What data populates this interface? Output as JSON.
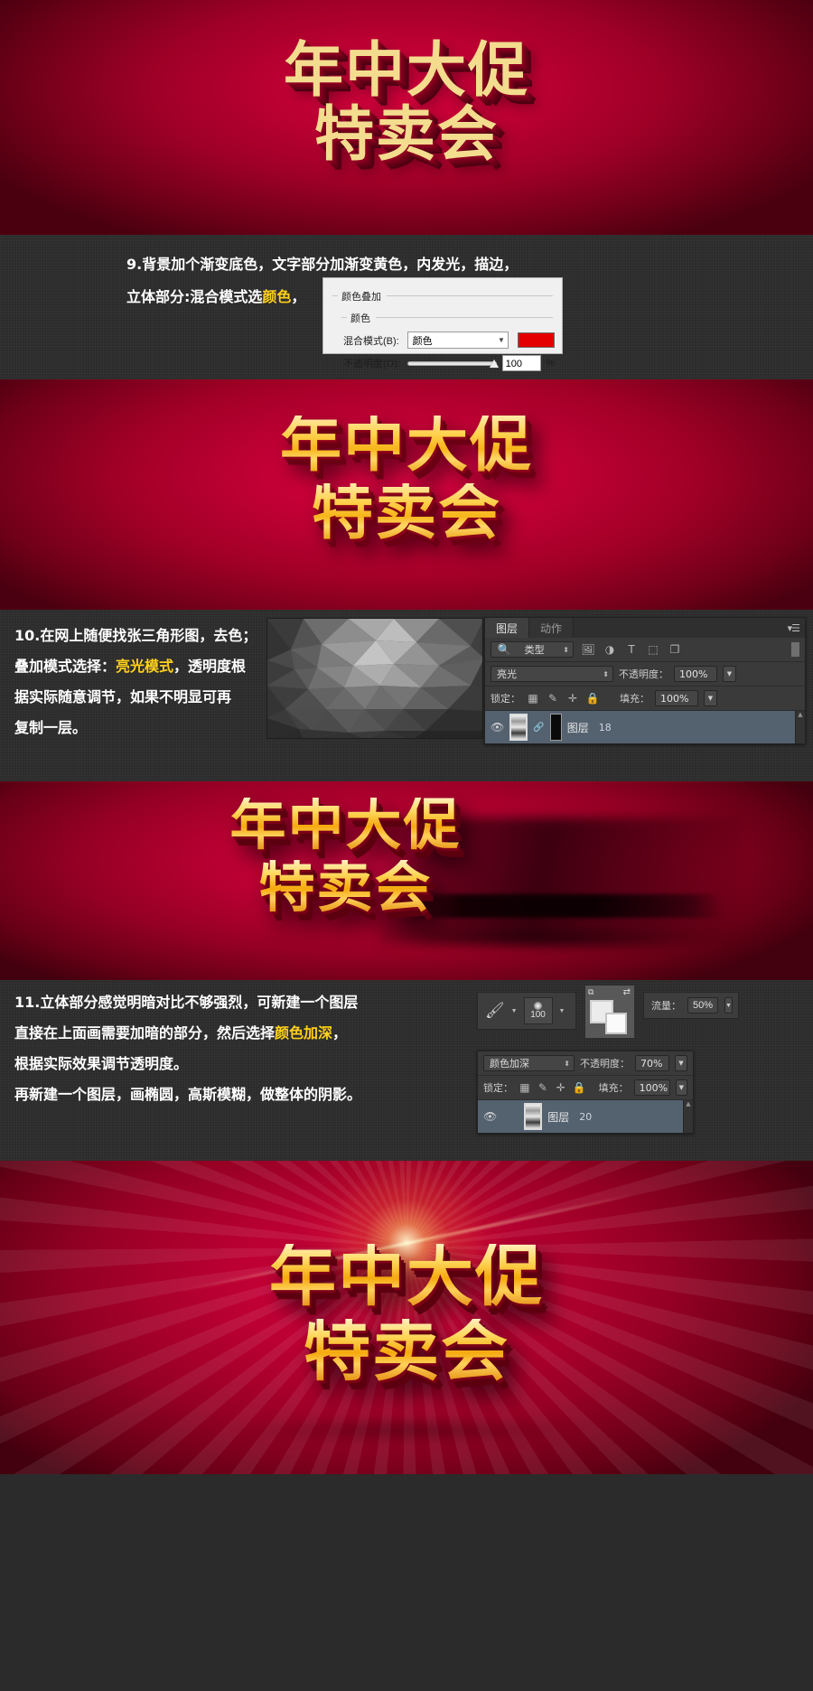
{
  "poster": {
    "line1": "年中大促",
    "line2": "特卖会"
  },
  "steps": {
    "s9": {
      "line1": "9.背景加个渐变底色，文字部分加渐变黄色，内发光，描边，",
      "line2_pre": "立体部分:混合模式选",
      "line2_hl": "颜色",
      "line2_post": "，"
    },
    "s10": {
      "line1": "10.在网上随便找张三角形图，去色；",
      "line2_pre": "叠加模式选择：",
      "line2_hl": "亮光模式",
      "line2_post": "，透明度根",
      "line3": "据实际随意调节，如果不明显可再",
      "line4": "复制一层。"
    },
    "s11": {
      "line1": "11.立体部分感觉明暗对比不够强烈，可新建一个图层",
      "line2_pre": "直接在上面画需要加暗的部分，然后选择",
      "line2_hl": "颜色加深",
      "line2_post": "，",
      "line3": "根据实际效果调节透明度。",
      "line4": "再新建一个图层，画椭圆，高斯模糊，做整体的阴影。"
    }
  },
  "color_overlay_dialog": {
    "group_title": "颜色叠加",
    "subgroup_title": "颜色",
    "blend_label": "混合模式(B):",
    "blend_value": "颜色",
    "opacity_label": "不透明度(O):",
    "opacity_value": "100",
    "percent": "%",
    "swatch_color": "#e40000"
  },
  "layers_panel_10": {
    "tab_layers": "图层",
    "tab_actions": "动作",
    "filter_label": "类型",
    "filter_icons": [
      "search-icon",
      "image-icon",
      "adjustment-icon",
      "text-icon",
      "shape-icon",
      "smartobject-icon"
    ],
    "blend_mode": "亮光",
    "opacity_label": "不透明度：",
    "opacity_value": "100%",
    "lock_label": "锁定：",
    "lock_icons": [
      "lock-transparency-icon",
      "lock-image-icon",
      "lock-position-icon",
      "lock-all-icon"
    ],
    "fill_label": "填充：",
    "fill_value": "100%",
    "layer_name": "图层",
    "layer_number": "18"
  },
  "brush_options_11": {
    "brush_icon": "brush-icon",
    "brush_size": "100",
    "flow_label": "流量：",
    "flow_value": "50%",
    "swap_icon": "swap-colors-icon",
    "default_icon": "default-colors-icon"
  },
  "layers_panel_11": {
    "blend_mode": "颜色加深",
    "opacity_label": "不透明度：",
    "opacity_value": "70%",
    "lock_label": "锁定：",
    "fill_label": "填充：",
    "fill_value": "100%",
    "layer_name": "图层",
    "layer_number": "20"
  },
  "icons": {
    "eye": "visibility-icon",
    "chevron": "chevron-down-icon"
  }
}
